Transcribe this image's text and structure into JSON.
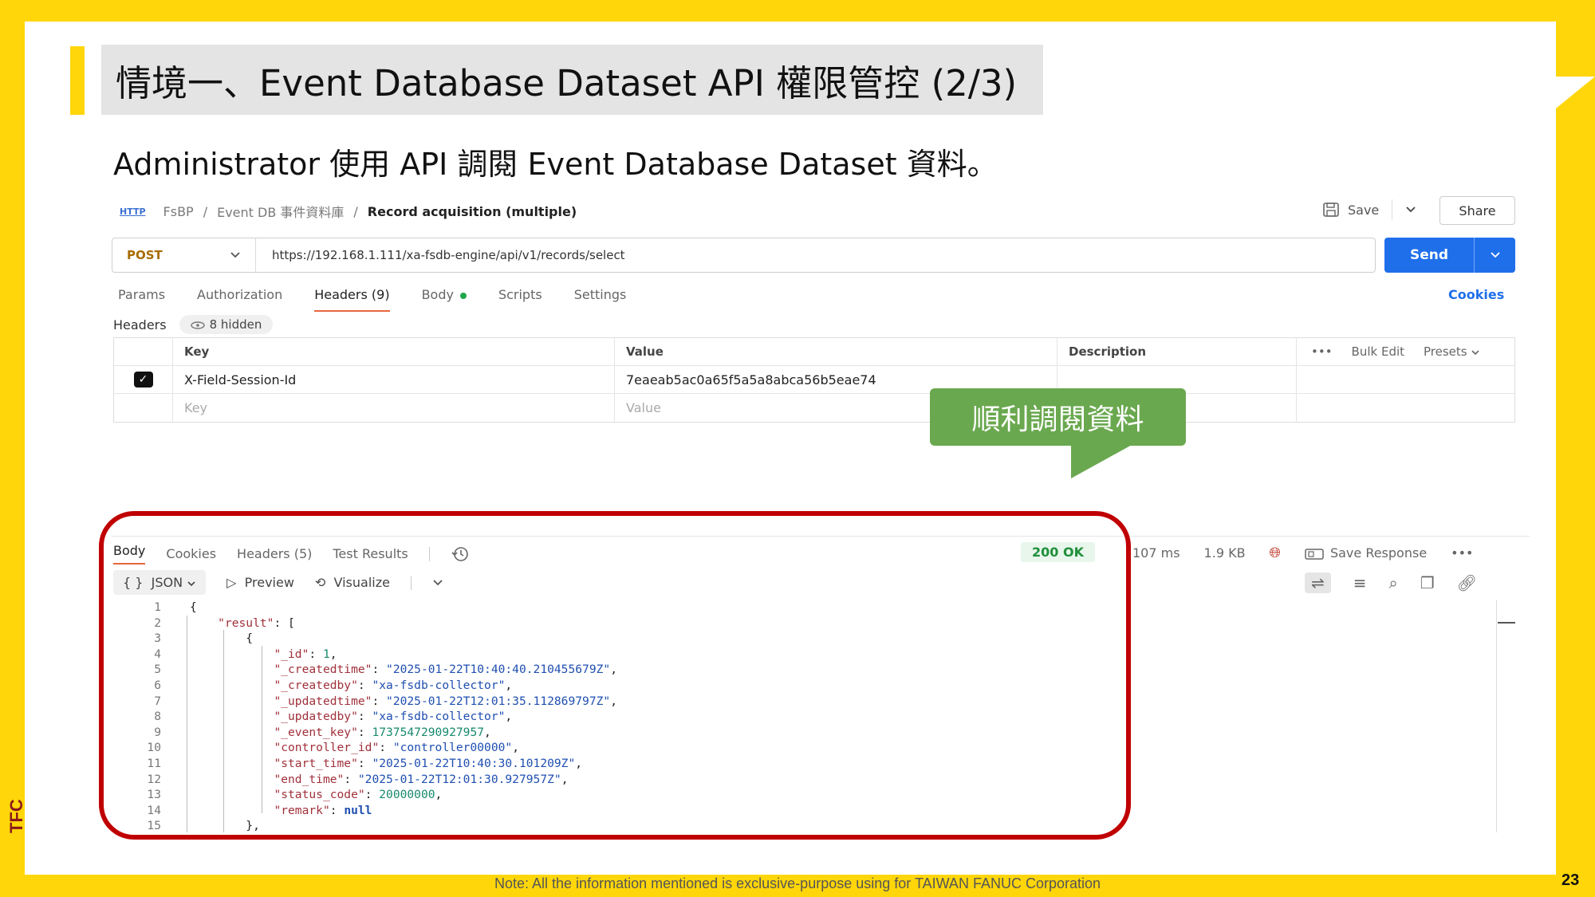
{
  "slide": {
    "title": "情境一、Event Database Dataset API 權限管控 (2/3)",
    "subtitle": "Administrator 使用 API 調閱 Event Database Dataset 資料。",
    "footnote": "Note: All the information mentioned is exclusive-purpose using for TAIWAN FANUC Corporation",
    "page_number": "23",
    "logo_text": "TFC",
    "callout": "順利調閱資料",
    "accent_color": "#FFD60A",
    "highlight_color": "#c00000",
    "callout_color": "#6aa84f"
  },
  "request": {
    "http_badge": "HTTP",
    "breadcrumb": [
      "FsBP",
      "/",
      "Event DB 事件資料庫",
      "/",
      "Record acquisition (multiple)"
    ],
    "save_label": "Save",
    "share_label": "Share",
    "method": "POST",
    "url": "https://192.168.1.111/xa-fsdb-engine/api/v1/records/select",
    "send_label": "Send",
    "tabs": [
      "Params",
      "Authorization",
      "Headers (9)",
      "Body",
      "Scripts",
      "Settings"
    ],
    "cookies_label": "Cookies",
    "headers_label": "Headers",
    "hidden_label": "8 hidden",
    "table": {
      "col_key": "Key",
      "col_value": "Value",
      "col_description": "Description",
      "more": "•••",
      "bulk_edit": "Bulk Edit",
      "presets": "Presets",
      "row_key": "X-Field-Session-Id",
      "row_value": "7eaeab5ac0a65f5a5a8abca56b5eae74",
      "placeholder_key": "Key",
      "placeholder_value": "Value"
    }
  },
  "response": {
    "tabs": [
      "Body",
      "Cookies",
      "Headers (5)",
      "Test Results"
    ],
    "status": "200 OK",
    "time": "107 ms",
    "size": "1.9 KB",
    "save_response": "Save Response",
    "more": "•••",
    "format": "JSON",
    "preview": "Preview",
    "visualize": "Visualize",
    "code_lines": [
      {
        "n": "1",
        "indent": 0,
        "parts": [
          [
            "p",
            "{"
          ]
        ]
      },
      {
        "n": "2",
        "indent": 1,
        "parts": [
          [
            "k",
            "\"result\""
          ],
          [
            "p",
            ": ["
          ]
        ]
      },
      {
        "n": "3",
        "indent": 2,
        "parts": [
          [
            "p",
            "{"
          ]
        ]
      },
      {
        "n": "4",
        "indent": 3,
        "parts": [
          [
            "k",
            "\"_id\""
          ],
          [
            "p",
            ": "
          ],
          [
            "n",
            "1"
          ],
          [
            "p",
            ","
          ]
        ]
      },
      {
        "n": "5",
        "indent": 3,
        "parts": [
          [
            "k",
            "\"_createdtime\""
          ],
          [
            "p",
            ": "
          ],
          [
            "s",
            "\"2025-01-22T10:40:40.210455679Z\""
          ],
          [
            "p",
            ","
          ]
        ]
      },
      {
        "n": "6",
        "indent": 3,
        "parts": [
          [
            "k",
            "\"_createdby\""
          ],
          [
            "p",
            ": "
          ],
          [
            "s",
            "\"xa-fsdb-collector\""
          ],
          [
            "p",
            ","
          ]
        ]
      },
      {
        "n": "7",
        "indent": 3,
        "parts": [
          [
            "k",
            "\"_updatedtime\""
          ],
          [
            "p",
            ": "
          ],
          [
            "s",
            "\"2025-01-22T12:01:35.112869797Z\""
          ],
          [
            "p",
            ","
          ]
        ]
      },
      {
        "n": "8",
        "indent": 3,
        "parts": [
          [
            "k",
            "\"_updatedby\""
          ],
          [
            "p",
            ": "
          ],
          [
            "s",
            "\"xa-fsdb-collector\""
          ],
          [
            "p",
            ","
          ]
        ]
      },
      {
        "n": "9",
        "indent": 3,
        "parts": [
          [
            "k",
            "\"_event_key\""
          ],
          [
            "p",
            ": "
          ],
          [
            "n",
            "1737547290927957"
          ],
          [
            "p",
            ","
          ]
        ]
      },
      {
        "n": "10",
        "indent": 3,
        "parts": [
          [
            "k",
            "\"controller_id\""
          ],
          [
            "p",
            ": "
          ],
          [
            "s",
            "\"controller00000\""
          ],
          [
            "p",
            ","
          ]
        ]
      },
      {
        "n": "11",
        "indent": 3,
        "parts": [
          [
            "k",
            "\"start_time\""
          ],
          [
            "p",
            ": "
          ],
          [
            "s",
            "\"2025-01-22T10:40:30.101209Z\""
          ],
          [
            "p",
            ","
          ]
        ]
      },
      {
        "n": "12",
        "indent": 3,
        "parts": [
          [
            "k",
            "\"end_time\""
          ],
          [
            "p",
            ": "
          ],
          [
            "s",
            "\"2025-01-22T12:01:30.927957Z\""
          ],
          [
            "p",
            ","
          ]
        ]
      },
      {
        "n": "13",
        "indent": 3,
        "parts": [
          [
            "k",
            "\"status_code\""
          ],
          [
            "p",
            ": "
          ],
          [
            "n",
            "20000000"
          ],
          [
            "p",
            ","
          ]
        ]
      },
      {
        "n": "14",
        "indent": 3,
        "parts": [
          [
            "k",
            "\"remark\""
          ],
          [
            "p",
            ": "
          ],
          [
            "nl",
            "null"
          ]
        ]
      },
      {
        "n": "15",
        "indent": 2,
        "parts": [
          [
            "p",
            "},"
          ]
        ]
      }
    ]
  }
}
